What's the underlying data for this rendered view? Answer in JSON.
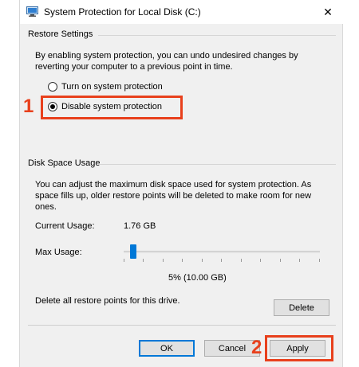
{
  "window": {
    "title": "System Protection for Local Disk (C:)",
    "close_glyph": "✕"
  },
  "restore_settings": {
    "label": "Restore Settings",
    "description_line1": "By enabling system protection, you can undo undesired changes by",
    "description_line2": "reverting your computer to a previous point in time.",
    "options": [
      {
        "label": "Turn on system protection",
        "checked": false
      },
      {
        "label": "Disable system protection",
        "checked": true
      }
    ]
  },
  "disk_space": {
    "label": "Disk Space Usage",
    "description_line1": "You can adjust the maximum disk space used for system protection. As",
    "description_line2": "space fills up, older restore points will be deleted to make room for new",
    "description_line3": "ones.",
    "current_usage_label": "Current Usage:",
    "current_usage_value": "1.76 GB",
    "max_usage_label": "Max Usage:",
    "max_usage_value": "5% (10.00 GB)",
    "max_usage_percent": 5,
    "delete_text": "Delete all restore points for this drive.",
    "delete_button": "Delete"
  },
  "footer": {
    "ok": "OK",
    "cancel": "Cancel",
    "apply": "Apply"
  },
  "annotations": {
    "step1": "1",
    "step2": "2",
    "highlight_color": "#e8401c"
  },
  "colors": {
    "accent": "#0078d7",
    "window_bg": "#f0f0f0"
  }
}
